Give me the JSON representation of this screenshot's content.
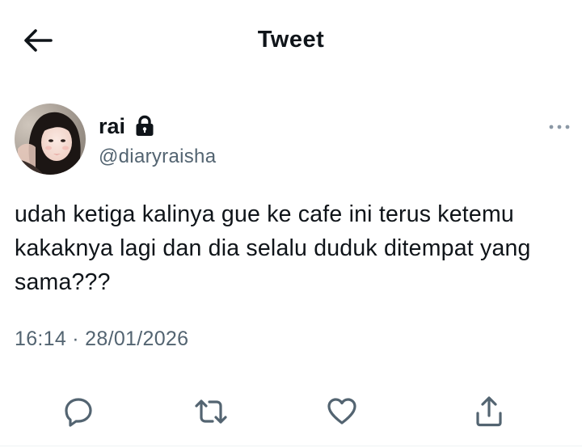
{
  "header": {
    "back_icon": "arrow-left-icon",
    "title": "Tweet"
  },
  "author": {
    "display_name": "rai",
    "handle": "@diaryraisha",
    "protected_icon": "lock-icon",
    "avatar": "profile-photo"
  },
  "tweet": {
    "text": "udah ketiga kalinya gue ke cafe ini terus ketemu kakaknya lagi dan dia selalu duduk ditempat yang sama???",
    "timestamp": "16:14 · 28/01/2026"
  },
  "more_icon": "more-horizontal-icon",
  "actions": [
    {
      "name": "reply",
      "icon": "reply-icon"
    },
    {
      "name": "retweet",
      "icon": "retweet-icon"
    },
    {
      "name": "like",
      "icon": "heart-icon"
    },
    {
      "name": "share",
      "icon": "share-icon"
    }
  ],
  "colors": {
    "text_primary": "#0f1419",
    "text_secondary": "#536471",
    "icon": "#536471",
    "background": "#ffffff"
  }
}
